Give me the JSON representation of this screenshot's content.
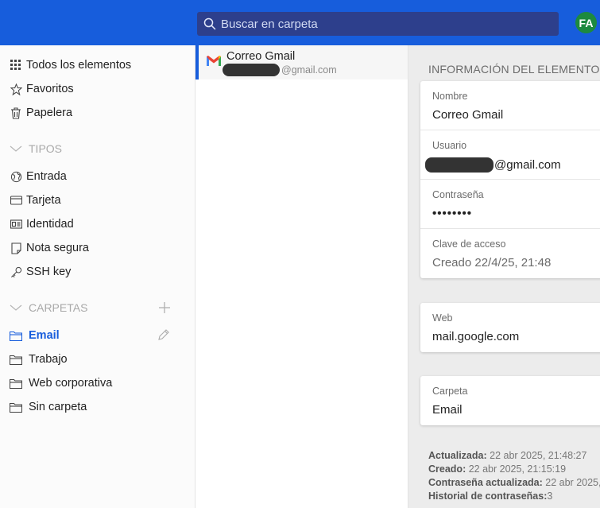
{
  "search": {
    "placeholder": "Buscar en carpeta"
  },
  "account": {
    "initials": "FA"
  },
  "sidebar": {
    "items": [
      {
        "label": "Todos los elementos",
        "icon": "grid-icon"
      },
      {
        "label": "Favoritos",
        "icon": "star-icon"
      },
      {
        "label": "Papelera",
        "icon": "trash-icon"
      }
    ],
    "types_heading": "TIPOS",
    "types": [
      {
        "label": "Entrada",
        "icon": "globe-icon"
      },
      {
        "label": "Tarjeta",
        "icon": "card-icon"
      },
      {
        "label": "Identidad",
        "icon": "id-card-icon"
      },
      {
        "label": "Nota segura",
        "icon": "note-icon"
      },
      {
        "label": "SSH key",
        "icon": "key-icon"
      }
    ],
    "folders_heading": "CARPETAS",
    "folders": [
      {
        "label": "Email",
        "active": true
      },
      {
        "label": "Trabajo",
        "active": false
      },
      {
        "label": "Web corporativa",
        "active": false
      },
      {
        "label": "Sin carpeta",
        "active": false
      }
    ]
  },
  "list": {
    "items": [
      {
        "title": "Correo Gmail",
        "subtitle_suffix": "@gmail.com"
      }
    ]
  },
  "detail": {
    "heading": "INFORMACIÓN DEL ELEMENTO",
    "card1": {
      "name_label": "Nombre",
      "name_value": "Correo Gmail",
      "user_label": "Usuario",
      "user_suffix": "@gmail.com",
      "password_label": "Contraseña",
      "password_value": "••••••••",
      "passkey_label": "Clave de acceso",
      "passkey_value": "Creado 22/4/25, 21:48"
    },
    "card2": {
      "web_label": "Web",
      "web_value": "mail.google.com"
    },
    "card3": {
      "folder_label": "Carpeta",
      "folder_value": "Email"
    },
    "meta": {
      "updated_label": "Actualizada:",
      "updated_value": "22 abr 2025, 21:48:27",
      "created_label": "Creado:",
      "created_value": "22 abr 2025, 21:15:19",
      "pw_updated_label": "Contraseña actualizada:",
      "pw_updated_value": "22 abr 2025,",
      "history_label": "Historial de contraseñas:",
      "history_value": "3"
    }
  },
  "colors": {
    "brand": "#175ddc",
    "avatar": "#1d8a3f"
  }
}
